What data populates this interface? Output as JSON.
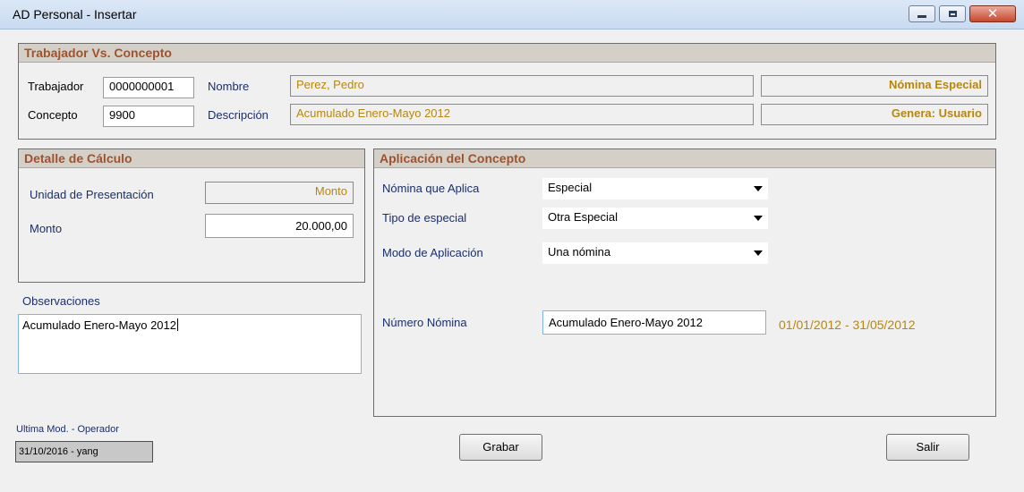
{
  "window": {
    "title": "AD Personal - Insertar",
    "controls": {
      "minimize_icon": "minimize-icon",
      "maximize_icon": "maximize-icon",
      "close_icon": "close-icon",
      "close_glyph": "✕"
    }
  },
  "trabajador_concepto": {
    "header": "Trabajador Vs. Concepto",
    "trabajador_label": "Trabajador",
    "trabajador_value": "0000000001",
    "nombre_label": "Nombre",
    "nombre_value": "Perez, Pedro",
    "nomina_badge": "Nómina Especial",
    "concepto_label": "Concepto",
    "concepto_value": "9900",
    "descripcion_label": "Descripción",
    "descripcion_value": "Acumulado Enero-Mayo 2012",
    "genera_badge": "Genera: Usuario"
  },
  "detalle": {
    "header": "Detalle de Cálculo",
    "unidad_label": "Unidad de Presentación",
    "unidad_value": "Monto",
    "monto_label": "Monto",
    "monto_value": "20.000,00"
  },
  "observaciones": {
    "label": "Observaciones",
    "value": "Acumulado Enero-Mayo 2012"
  },
  "aplicacion": {
    "header": "Aplicación del Concepto",
    "nomina_aplica_label": "Nómina que Aplica",
    "nomina_aplica_value": "Especial",
    "tipo_especial_label": "Tipo de especial",
    "tipo_especial_value": "Otra Especial",
    "modo_label": "Modo de Aplicación",
    "modo_value": "Una nómina",
    "numero_label": "Número Nómina",
    "numero_value": "Acumulado Enero-Mayo 2012",
    "rango_fechas": "01/01/2012 - 31/05/2012"
  },
  "footer": {
    "ultima_mod_label": "Ultima Mod. - Operador",
    "ultima_mod_value": "31/10/2016 - yang",
    "grabar_label": "Grabar",
    "salir_label": "Salir"
  },
  "colors": {
    "accent_text": "#b8860b",
    "header_text": "#a0522d",
    "header_bg": "#d4d0c8",
    "label_blue": "#1a2f6b"
  }
}
